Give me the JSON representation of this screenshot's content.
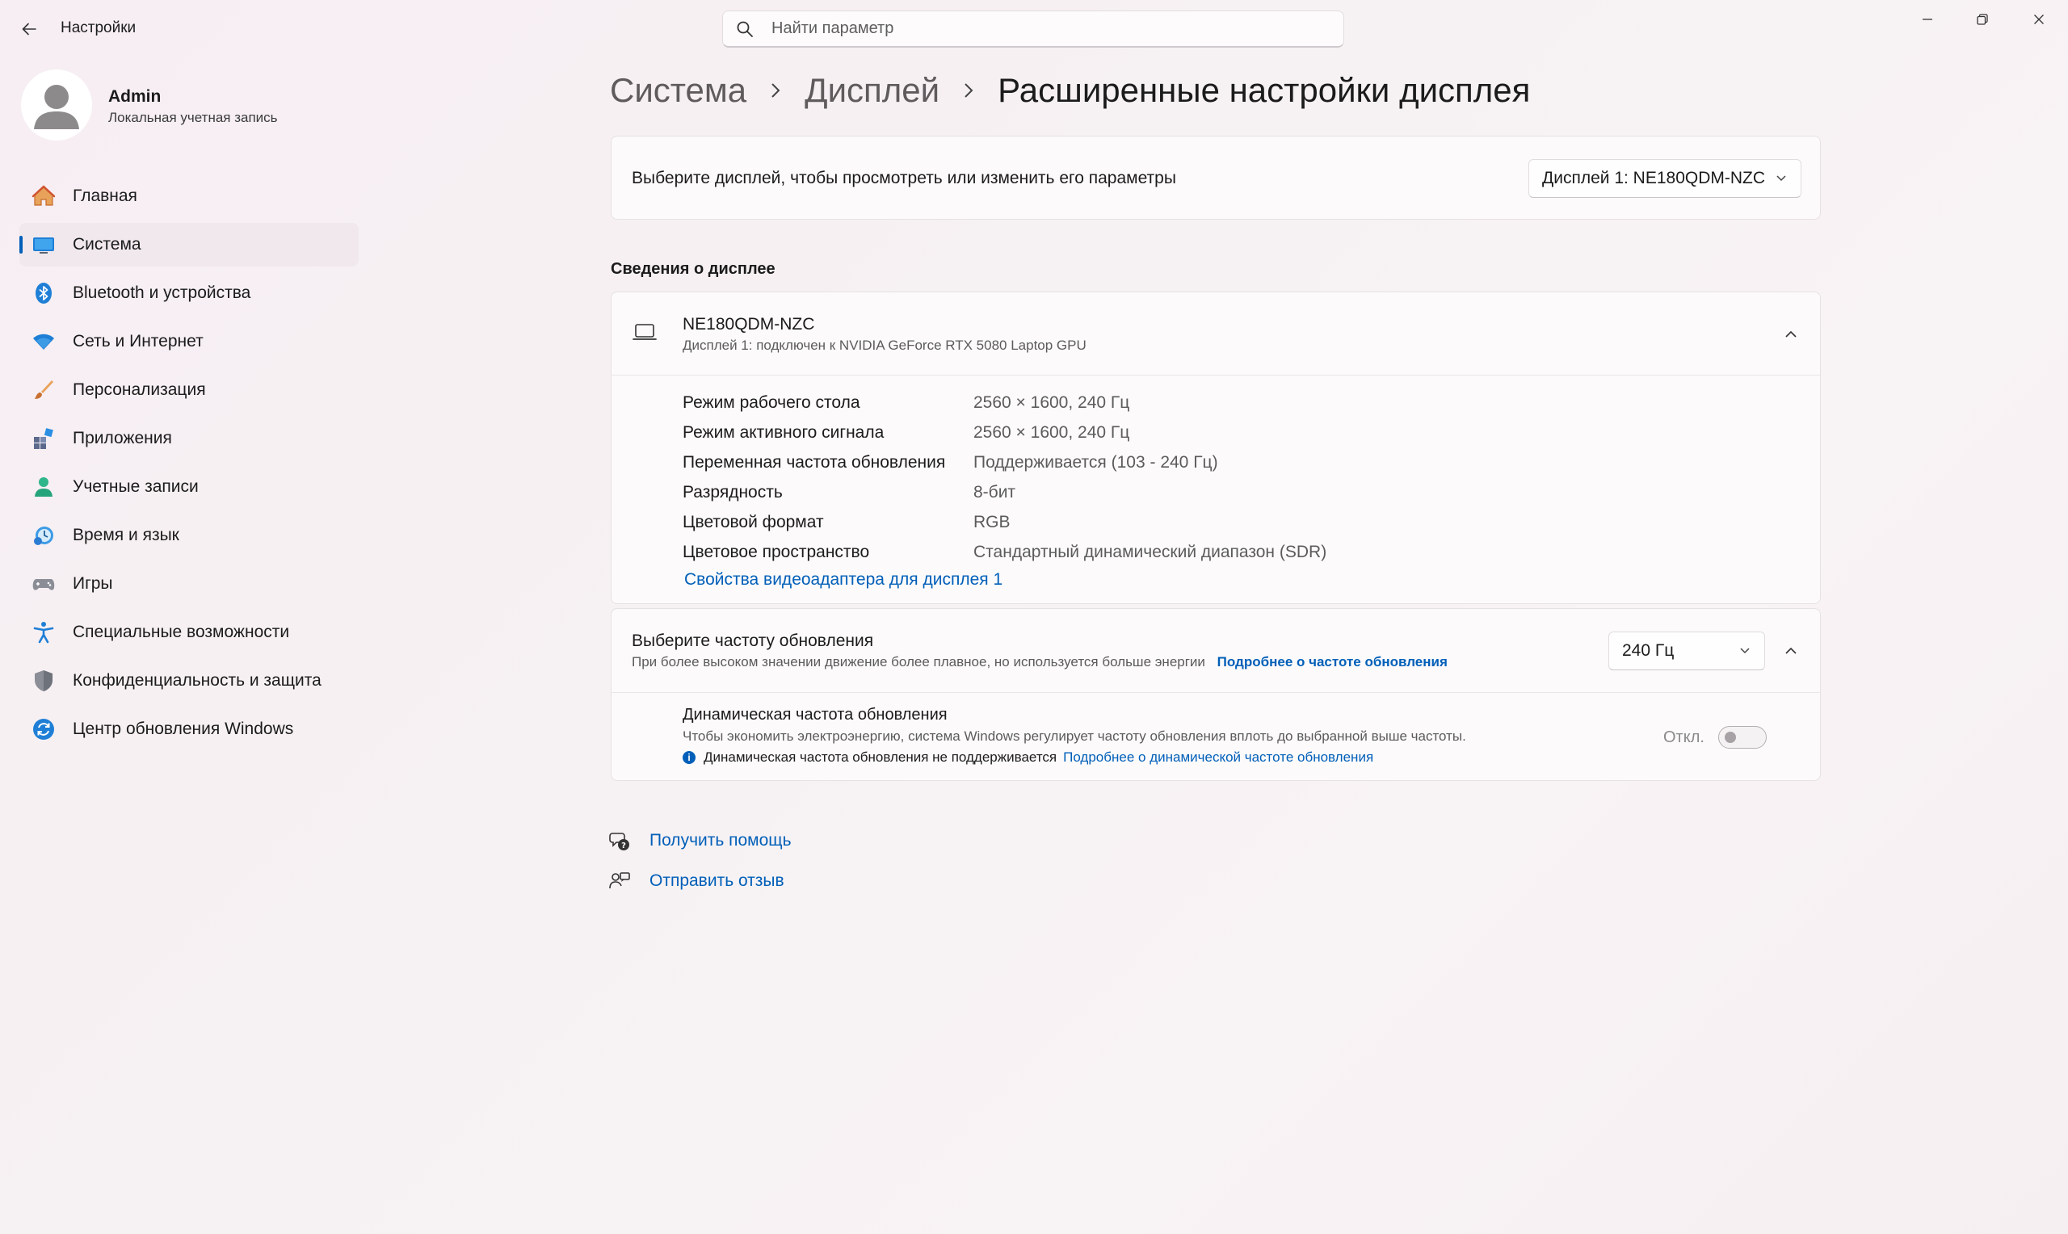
{
  "window": {
    "title": "Настройки",
    "search_placeholder": "Найти параметр"
  },
  "profile": {
    "name": "Admin",
    "account_type": "Локальная учетная запись"
  },
  "sidebar": {
    "items": [
      {
        "label": "Главная",
        "icon": "home-icon"
      },
      {
        "label": "Система",
        "icon": "system-icon",
        "active": true
      },
      {
        "label": "Bluetooth и устройства",
        "icon": "bluetooth-icon"
      },
      {
        "label": "Сеть и Интернет",
        "icon": "wifi-icon"
      },
      {
        "label": "Персонализация",
        "icon": "brush-icon"
      },
      {
        "label": "Приложения",
        "icon": "apps-icon"
      },
      {
        "label": "Учетные записи",
        "icon": "accounts-icon"
      },
      {
        "label": "Время и язык",
        "icon": "time-language-icon"
      },
      {
        "label": "Игры",
        "icon": "gamepad-icon"
      },
      {
        "label": "Специальные возможности",
        "icon": "accessibility-icon"
      },
      {
        "label": "Конфиденциальность и защита",
        "icon": "shield-icon"
      },
      {
        "label": "Центр обновления Windows",
        "icon": "update-icon"
      }
    ]
  },
  "breadcrumb": {
    "level1": "Система",
    "level2": "Дисплей",
    "current": "Расширенные настройки дисплея"
  },
  "display_select": {
    "label": "Выберите дисплей, чтобы просмотреть или изменить его параметры",
    "value": "Дисплей 1: NE180QDM-NZC"
  },
  "display_info": {
    "section_title": "Сведения о дисплее",
    "monitor_name": "NE180QDM-NZC",
    "monitor_sub": "Дисплей 1: подключен к NVIDIA GeForce RTX 5080 Laptop GPU",
    "rows": [
      {
        "key": "Режим рабочего стола",
        "value": "2560 × 1600, 240 Гц"
      },
      {
        "key": "Режим активного сигнала",
        "value": "2560 × 1600, 240 Гц"
      },
      {
        "key": "Переменная частота обновления",
        "value": "Поддерживается (103 - 240 Гц)"
      },
      {
        "key": "Разрядность",
        "value": "8-бит"
      },
      {
        "key": "Цветовой формат",
        "value": "RGB"
      },
      {
        "key": "Цветовое пространство",
        "value": "Стандартный динамический диапазон (SDR)"
      }
    ],
    "adapter_link": "Свойства видеоадаптера для дисплея 1"
  },
  "refresh_rate": {
    "title": "Выберите частоту обновления",
    "subtitle": "При более высоком значении движение более плавное, но используется больше энергии",
    "learn_more": "Подробнее о частоте обновления",
    "value": "240 Гц",
    "dynamic_title": "Динамическая частота обновления",
    "dynamic_sub": "Чтобы экономить электроэнергию, система Windows регулирует частоту обновления вплоть до выбранной выше частоты.",
    "dynamic_note": "Динамическая частота обновления не поддерживается",
    "dynamic_link": "Подробнее о динамической частоте обновления",
    "toggle_label": "Откл.",
    "toggle_on": false
  },
  "help": {
    "get_help": "Получить помощь",
    "feedback": "Отправить отзыв"
  },
  "colors": {
    "accent": "#005fb8",
    "background": "#f7eff3"
  }
}
